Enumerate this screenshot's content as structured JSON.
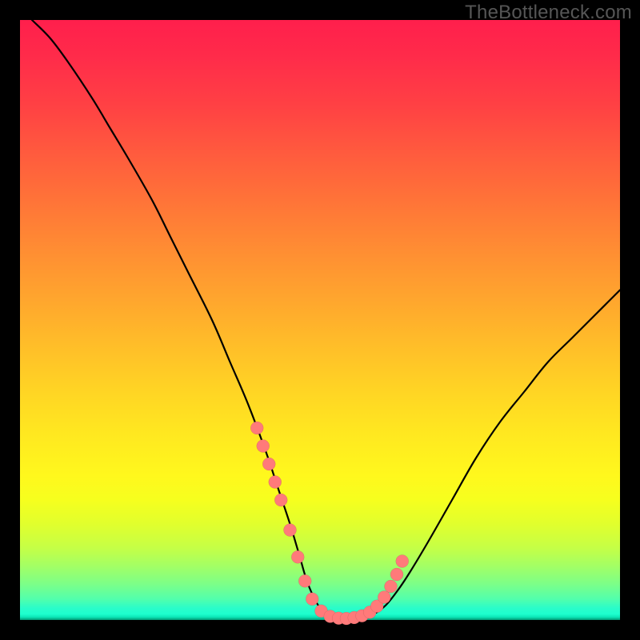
{
  "watermark": "TheBottleneck.com",
  "colors": {
    "frame_bg": "#000000",
    "curve": "#000000",
    "marker": "#ff7a7a",
    "watermark": "#565656"
  },
  "chart_data": {
    "type": "line",
    "title": "",
    "xlabel": "",
    "ylabel": "",
    "xlim": [
      0,
      100
    ],
    "ylim": [
      0,
      100
    ],
    "x": [
      2,
      5,
      8,
      12,
      15,
      18,
      22,
      25,
      28,
      32,
      35,
      38,
      41,
      43,
      45,
      46.5,
      48,
      50,
      52,
      54.5,
      57,
      59,
      61,
      63,
      65,
      68,
      72,
      76,
      80,
      84,
      88,
      92,
      96,
      100
    ],
    "values": [
      100,
      97,
      93,
      87,
      82,
      77,
      70,
      64,
      58,
      50,
      43,
      36,
      28,
      22,
      16,
      11,
      6,
      2,
      0.5,
      0.2,
      0.3,
      1,
      2.5,
      5,
      8,
      13,
      20,
      27,
      33,
      38,
      43,
      47,
      51,
      55
    ],
    "markers_x": [
      39.5,
      40.5,
      41.5,
      42.5,
      43.5,
      45,
      46.3,
      47.5,
      48.7,
      50.2,
      51.7,
      53.1,
      54.4,
      55.7,
      57,
      58.3,
      59.5,
      60.7,
      61.8,
      62.8,
      63.7
    ],
    "markers_y": [
      32,
      29,
      26,
      23,
      20,
      15,
      10.5,
      6.5,
      3.5,
      1.5,
      0.6,
      0.3,
      0.25,
      0.4,
      0.7,
      1.3,
      2.3,
      3.8,
      5.6,
      7.6,
      9.8
    ]
  }
}
